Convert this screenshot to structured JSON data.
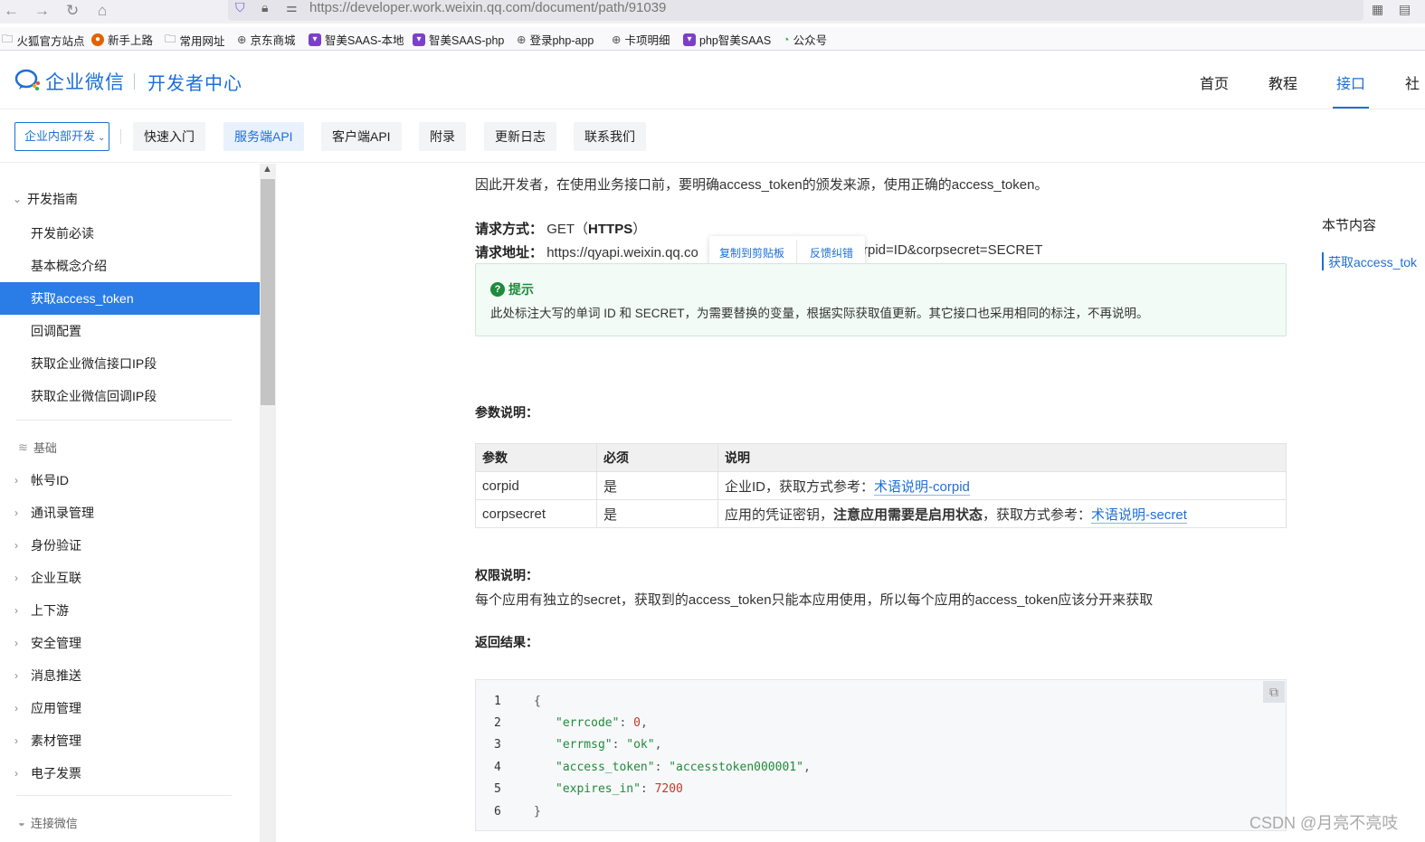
{
  "browser": {
    "url": "https://developer.work.weixin.qq.com/document/path/91039",
    "bookmarks": [
      "火狐官方站点",
      "新手上路",
      "常用网址",
      "京东商城",
      "智美SAAS-本地",
      "智美SAAS-php",
      "登录php-app",
      "卡项明细",
      "php智美SAAS",
      "公众号"
    ]
  },
  "header": {
    "logo": "企业微信",
    "subtitle": "开发者中心",
    "nav": [
      "首页",
      "教程",
      "接口",
      "社"
    ],
    "active_nav": "接口"
  },
  "subnav": {
    "scope": "企业内部开发",
    "tabs": [
      "快速入门",
      "服务端API",
      "客户端API",
      "附录",
      "更新日志",
      "联系我们"
    ],
    "active_tab": "服务端API"
  },
  "sidebar": {
    "group_title": "开发指南",
    "items": [
      "开发前必读",
      "基本概念介绍",
      "获取access_token",
      "回调配置",
      "获取企业微信接口IP段",
      "获取企业微信回调IP段"
    ],
    "active_item": "获取access_token",
    "category": "基础",
    "collapsed": [
      "帐号ID",
      "通讯录管理",
      "身份验证",
      "企业互联",
      "上下游",
      "安全管理",
      "消息推送",
      "应用管理",
      "素材管理",
      "电子发票"
    ],
    "category2": "连接微信"
  },
  "content": {
    "intro": "因此开发者，在使用业务接口前，要明确access_token的颁发来源，使用正确的access_token。",
    "method_label": "请求方式：",
    "method_value": "GET（",
    "method_proto": "HTTPS",
    "method_close": "）",
    "url_label": "请求地址：",
    "url_value_start": "https://qyapi.weixin.qq.co",
    "url_value_end": "rpid=ID&corpsecret=SECRET",
    "tooltip": {
      "copy": "复制到剪贴板",
      "report": "反馈纠错"
    },
    "tip": {
      "title": "提示",
      "body": "此处标注大写的单词 ID 和 SECRET，为需要替换的变量，根据实际获取值更新。其它接口也采用相同的标注，不再说明。"
    },
    "params_label": "参数说明：",
    "params_table": {
      "headers": [
        "参数",
        "必须",
        "说明"
      ],
      "rows": [
        {
          "param": "corpid",
          "required": "是",
          "desc": "企业ID，获取方式参考：",
          "link": "术语说明-corpid"
        },
        {
          "param": "corpsecret",
          "required": "是",
          "desc_a": "应用的凭证密钥，",
          "desc_bold": "注意应用需要是启用状态",
          "desc_b": "，获取方式参考：",
          "link": "术语说明-secret"
        }
      ]
    },
    "perm_label": "权限说明：",
    "perm_text": "每个应用有独立的secret，获取到的access_token只能本应用使用，所以每个应用的access_token应该分开来获取",
    "return_label": "返回结果：",
    "code": {
      "line_numbers": [
        "1",
        "2",
        "3",
        "4",
        "5",
        "6"
      ],
      "open": "{",
      "errcode_key": "\"errcode\"",
      "errcode_val": "0",
      "errmsg_key": "\"errmsg\"",
      "errmsg_val": "\"ok\"",
      "token_key": "\"access_token\"",
      "token_val": "\"accesstoken000001\"",
      "expires_key": "\"expires_in\"",
      "expires_val": "7200",
      "close": "}"
    }
  },
  "toc": {
    "title": "本节内容",
    "item": "获取access_tok"
  },
  "watermark": "CSDN @月亮不亮吱"
}
